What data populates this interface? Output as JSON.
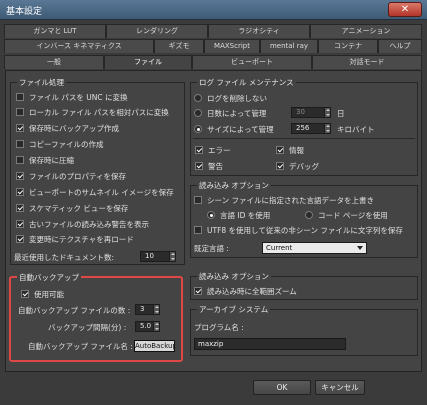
{
  "window": {
    "title": "基本設定",
    "close_glyph": "✕"
  },
  "tabs_row1": [
    "ガンマと LUT",
    "レンダリング",
    "ラジオシティ",
    "アニメーション"
  ],
  "tabs_row2": [
    "インバース キネマティクス",
    "ギズモ",
    "MAXScript",
    "mental ray",
    "コンテナ",
    "ヘルプ"
  ],
  "tabs_row3": [
    "一般",
    "ファイル",
    "ビューポート",
    "対話モード"
  ],
  "file_processing": {
    "title": "ファイル処理",
    "options": [
      {
        "label": "ファイル パスを UNC に変換",
        "checked": false
      },
      {
        "label": "ローカル ファイル パスを相対パスに変換",
        "checked": false
      },
      {
        "label": "保存時にバックアップ作成",
        "checked": true
      },
      {
        "label": "コピーファイルの作成",
        "checked": false
      },
      {
        "label": "保存時に圧縮",
        "checked": false
      },
      {
        "label": "ファイルのプロパティを保存",
        "checked": true
      },
      {
        "label": "ビューポートのサムネイル イメージを保存",
        "checked": true
      },
      {
        "label": "スケマティック ビューを保存",
        "checked": true
      },
      {
        "label": "古いファイルの読み込み警告を表示",
        "checked": true
      },
      {
        "label": "変更時にテクスチャを再ロード",
        "checked": true
      }
    ],
    "recent_docs_label": "最近使用したドキュメント数:",
    "recent_docs_value": "10"
  },
  "auto_backup": {
    "title": "自動バックアップ",
    "enable_label": "使用可能",
    "enable_checked": true,
    "count_label": "自動バックアップ ファイルの数 :",
    "count_value": "3",
    "interval_label": "バックアップ間隔(分) :",
    "interval_value": "5.0",
    "name_label": "自動バックアップ ファイル名 :",
    "name_value": "AutoBackup"
  },
  "log_maintenance": {
    "title": "ログ ファイル メンテナンス",
    "never_delete": "ログを削除しない",
    "by_days_label": "日数によって管理",
    "by_days_value": "30",
    "days_unit": "日",
    "by_size_label": "サイズによって管理",
    "by_size_value": "256",
    "size_unit": "キロバイト",
    "selected": "size",
    "types": [
      {
        "label": "エラー",
        "checked": true
      },
      {
        "label": "情報",
        "checked": true
      },
      {
        "label": "警告",
        "checked": true
      },
      {
        "label": "デバッグ",
        "checked": true
      }
    ]
  },
  "load_options": {
    "title": "読み込み オプション",
    "overwrite_label": "シーン ファイルに指定された言語データを上書き",
    "overwrite_checked": false,
    "lang_id": "言語 ID を使用",
    "code_page": "コード ページを使用",
    "utf8_label": "UTF8 を使用して従来の非シーン ファイルに文字列を保存",
    "utf8_checked": false,
    "default_lang_label": "既定言語 :",
    "default_lang_value": "Current"
  },
  "load_options2": {
    "title": "読み込み オプション",
    "zoom_label": "読み込み時に全範囲ズーム",
    "zoom_checked": true
  },
  "archive": {
    "title": "アーカイブ システム",
    "program_label": "プログラム名 :",
    "program_value": "maxzip"
  },
  "buttons": {
    "ok": "OK",
    "cancel": "キャンセル"
  }
}
